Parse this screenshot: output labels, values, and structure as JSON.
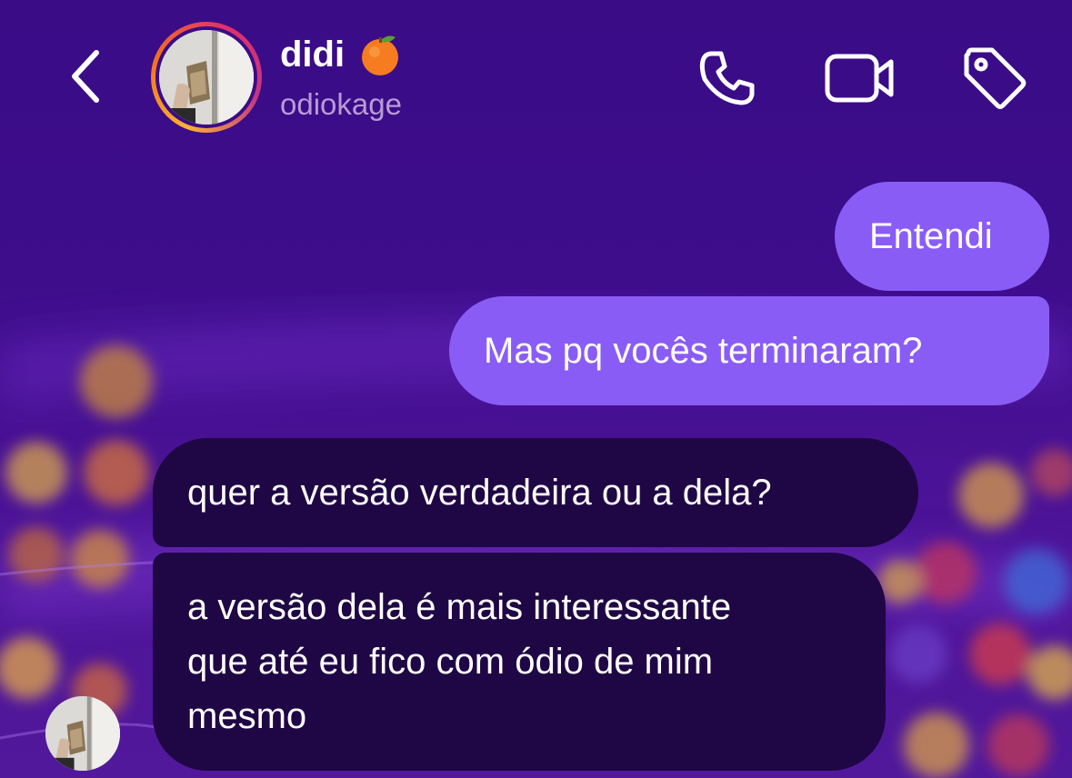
{
  "header": {
    "display_name": "didi",
    "name_emoji": "🍊",
    "username": "odiokage",
    "icons": [
      "back-icon",
      "phone-icon",
      "video-camera-icon",
      "tag-icon"
    ]
  },
  "messages": [
    {
      "direction": "sent",
      "text": "Entendi"
    },
    {
      "direction": "sent",
      "text": "Mas pq vocês terminaram?"
    },
    {
      "direction": "received",
      "text": "quer a versão verdadeira ou a dela?"
    },
    {
      "direction": "received",
      "lines": [
        "a versão dela é mais interessante",
        "que até eu fico com ódio de mim",
        "mesmo"
      ]
    }
  ],
  "colors": {
    "background": "#3d0d8c",
    "sent_bubble": "#8a5cf6",
    "received_bubble": "#1f0745",
    "username": "#b99ad6"
  }
}
